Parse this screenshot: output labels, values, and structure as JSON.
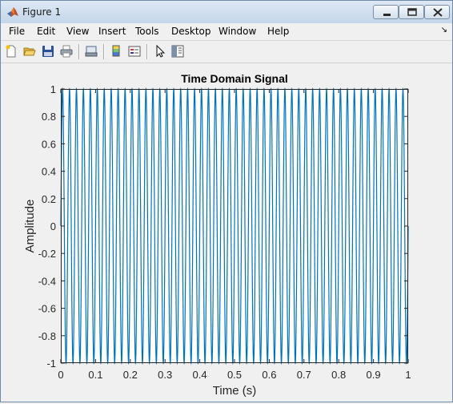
{
  "window": {
    "title": "Figure 1"
  },
  "menu": {
    "items": [
      "File",
      "Edit",
      "View",
      "Insert",
      "Tools",
      "Desktop",
      "Window",
      "Help"
    ]
  },
  "toolbar": {
    "buttons": [
      "new-figure-icon",
      "open-file-icon",
      "save-icon",
      "print-icon",
      "print-preview-icon",
      "insert-colorbar-icon",
      "insert-legend-icon",
      "edit-plot-arrow-icon",
      "property-editor-icon"
    ]
  },
  "chart_data": {
    "type": "line",
    "title": "Time Domain Signal",
    "xlabel": "Time (s)",
    "ylabel": "Amplitude",
    "xlim": [
      0,
      1
    ],
    "ylim": [
      -1,
      1
    ],
    "xticks": [
      "0",
      "0.1",
      "0.2",
      "0.3",
      "0.4",
      "0.5",
      "0.6",
      "0.7",
      "0.8",
      "0.9",
      "1"
    ],
    "yticks": [
      "1",
      "0.8",
      "0.6",
      "0.4",
      "0.2",
      "0",
      "-0.2",
      "-0.4",
      "-0.6",
      "-0.8",
      "-1"
    ],
    "series": [
      {
        "function": "sin",
        "frequency_hz": 50,
        "amplitude": 1,
        "x_start": 0,
        "x_end": 1,
        "color": "#0072bd"
      }
    ],
    "grid": false,
    "box": true
  },
  "colors": {
    "line": "#0072bd",
    "axes_background": "#ffffff",
    "figure_background": "#f0f0f0"
  }
}
